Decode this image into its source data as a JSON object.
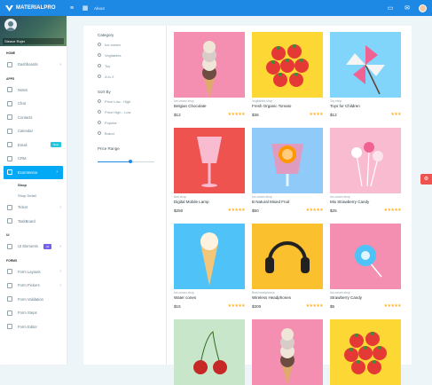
{
  "brand": {
    "name": "MATERIALPRO"
  },
  "topbar": {
    "about": "About",
    "menu_icon": "menu-icon",
    "grid_icon": "apps-icon",
    "icons": [
      "message-icon",
      "mail-icon",
      "avatar"
    ]
  },
  "profile": {
    "name": "Steave Rojer"
  },
  "sidebar": {
    "sections": [
      {
        "caption": "HOME",
        "items": [
          {
            "label": "Dashboards",
            "icon": "gauge-icon",
            "chevron": true
          }
        ]
      },
      {
        "caption": "APPS",
        "items": [
          {
            "label": "Notes",
            "icon": "note-icon"
          },
          {
            "label": "Chat",
            "icon": "chat-icon"
          },
          {
            "label": "Contacts",
            "icon": "contacts-icon"
          },
          {
            "label": "Calendar",
            "icon": "calendar-icon"
          },
          {
            "label": "Email",
            "icon": "email-icon",
            "badge": "New",
            "badge_color": "#26c6da"
          },
          {
            "label": "CRM",
            "icon": "crm-icon"
          },
          {
            "label": "Ecommerce",
            "icon": "cart-icon",
            "chevron": true,
            "active": true,
            "sub": [
              {
                "label": "Shop",
                "current": true
              },
              {
                "label": "Shop Detail"
              }
            ]
          },
          {
            "label": "Ticket",
            "icon": "ticket-icon",
            "chevron": true
          },
          {
            "label": "TaskBoard",
            "icon": "taskboard-icon"
          }
        ]
      },
      {
        "caption": "UI",
        "items": [
          {
            "label": "UI Elements",
            "icon": "ui-icon",
            "badge": "22",
            "badge_color": "#7460ee",
            "chevron": true
          }
        ]
      },
      {
        "caption": "FORMS",
        "items": [
          {
            "label": "Form Layouts",
            "icon": "form-layout-icon",
            "chevron": true
          },
          {
            "label": "Form Pickers",
            "icon": "form-pickers-icon",
            "chevron": true
          },
          {
            "label": "Form Validation",
            "icon": "form-validation-icon"
          },
          {
            "label": "Form Steps",
            "icon": "form-steps-icon"
          },
          {
            "label": "Form Editor",
            "icon": "form-editor-icon"
          }
        ]
      }
    ]
  },
  "filters": {
    "category": {
      "title": "Category",
      "options": [
        "Ice-cream",
        "Vegitables",
        "Toy",
        "A to Z"
      ]
    },
    "sort": {
      "title": "Sort By",
      "options": [
        "Price Low - High",
        "Price High - Low",
        "Popular",
        "Brand"
      ]
    },
    "price": {
      "title": "Price Range",
      "slider_value": 0.58
    }
  },
  "products": [
    {
      "shop": "Ice-cream shop",
      "name": "Belgian Chocolate",
      "price": "$12",
      "rating": 5,
      "bg": "#f48fb1",
      "art": "icecream"
    },
    {
      "shop": "Vegitables shop",
      "name": "Fresh Organic Tomato",
      "price": "$36",
      "rating": 4,
      "bg": "#fdd835",
      "art": "tomato"
    },
    {
      "shop": "Toy shop",
      "name": "Toys for Children",
      "price": "$12",
      "rating": 3,
      "bg": "#81d4fa",
      "art": "pinwheel"
    },
    {
      "shop": "Bad shop",
      "name": "Digital Mobile Lamp",
      "price": "$250",
      "rating": 5,
      "bg": "#ef5350",
      "art": "glass"
    },
    {
      "shop": "Ice-cream shop",
      "name": "B Natural Mixed Fruit",
      "price": "$50",
      "rating": 5,
      "bg": "#90caf9",
      "art": "juice"
    },
    {
      "shop": "Ice-cream shop",
      "name": "Mix Strawberry Candy",
      "price": "$25",
      "rating": 5,
      "bg": "#f8bbd0",
      "art": "lollipop"
    },
    {
      "shop": "Ice-cream shop",
      "name": "Water cones",
      "price": "$15",
      "rating": 5,
      "bg": "#4fc3f7",
      "art": "cone"
    },
    {
      "shop": "Best headphones",
      "name": "Wireless Headphones",
      "price": "$300",
      "rating": 5,
      "bg": "#fbc02d",
      "art": "headphones"
    },
    {
      "shop": "Ice-cream shop",
      "name": "Strawberry Candy",
      "price": "$5",
      "rating": 5,
      "bg": "#f48fb1",
      "art": "candy"
    },
    {
      "shop": "",
      "name": "",
      "price": "",
      "rating": 0,
      "bg": "#c8e6c9",
      "art": "cherries"
    },
    {
      "shop": "",
      "name": "",
      "price": "",
      "rating": 0,
      "bg": "#f48fb1",
      "art": "icecream"
    },
    {
      "shop": "",
      "name": "",
      "price": "",
      "rating": 0,
      "bg": "#fdd835",
      "art": "tomato"
    }
  ]
}
